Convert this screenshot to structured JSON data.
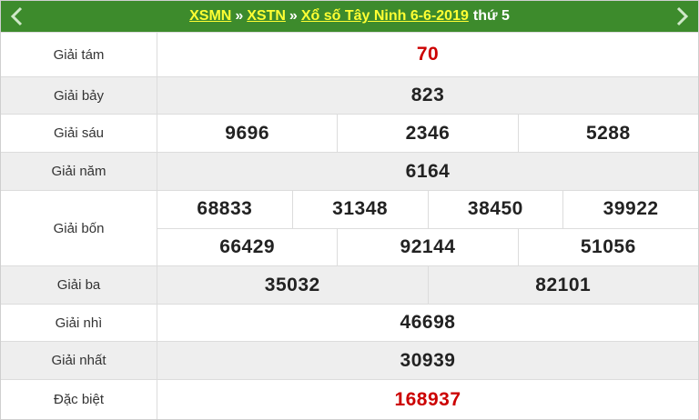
{
  "header": {
    "link_xsmn": "XSMN",
    "link_xstn": "XSTN",
    "link_title": "Xổ số Tây Ninh 6-6-2019",
    "separator": "»",
    "weekday": "thứ 5"
  },
  "colors": {
    "header_bg": "#3d8b2c",
    "link": "#ffff33",
    "highlight": "#cc0000"
  },
  "prizes": [
    {
      "label": "Giải tám",
      "lines": [
        [
          "70"
        ]
      ],
      "highlight": true
    },
    {
      "label": "Giải bảy",
      "lines": [
        [
          "823"
        ]
      ]
    },
    {
      "label": "Giải sáu",
      "lines": [
        [
          "9696",
          "2346",
          "5288"
        ]
      ]
    },
    {
      "label": "Giải năm",
      "lines": [
        [
          "6164"
        ]
      ]
    },
    {
      "label": "Giải bốn",
      "lines": [
        [
          "68833",
          "31348",
          "38450",
          "39922"
        ],
        [
          "66429",
          "92144",
          "51056"
        ]
      ]
    },
    {
      "label": "Giải ba",
      "lines": [
        [
          "35032",
          "82101"
        ]
      ]
    },
    {
      "label": "Giải nhì",
      "lines": [
        [
          "46698"
        ]
      ]
    },
    {
      "label": "Giải nhất",
      "lines": [
        [
          "30939"
        ]
      ]
    },
    {
      "label": "Đặc biệt",
      "lines": [
        [
          "168937"
        ]
      ],
      "highlight": true
    }
  ],
  "icons": {
    "prev": "chevron-left-icon",
    "next": "chevron-right-icon"
  }
}
